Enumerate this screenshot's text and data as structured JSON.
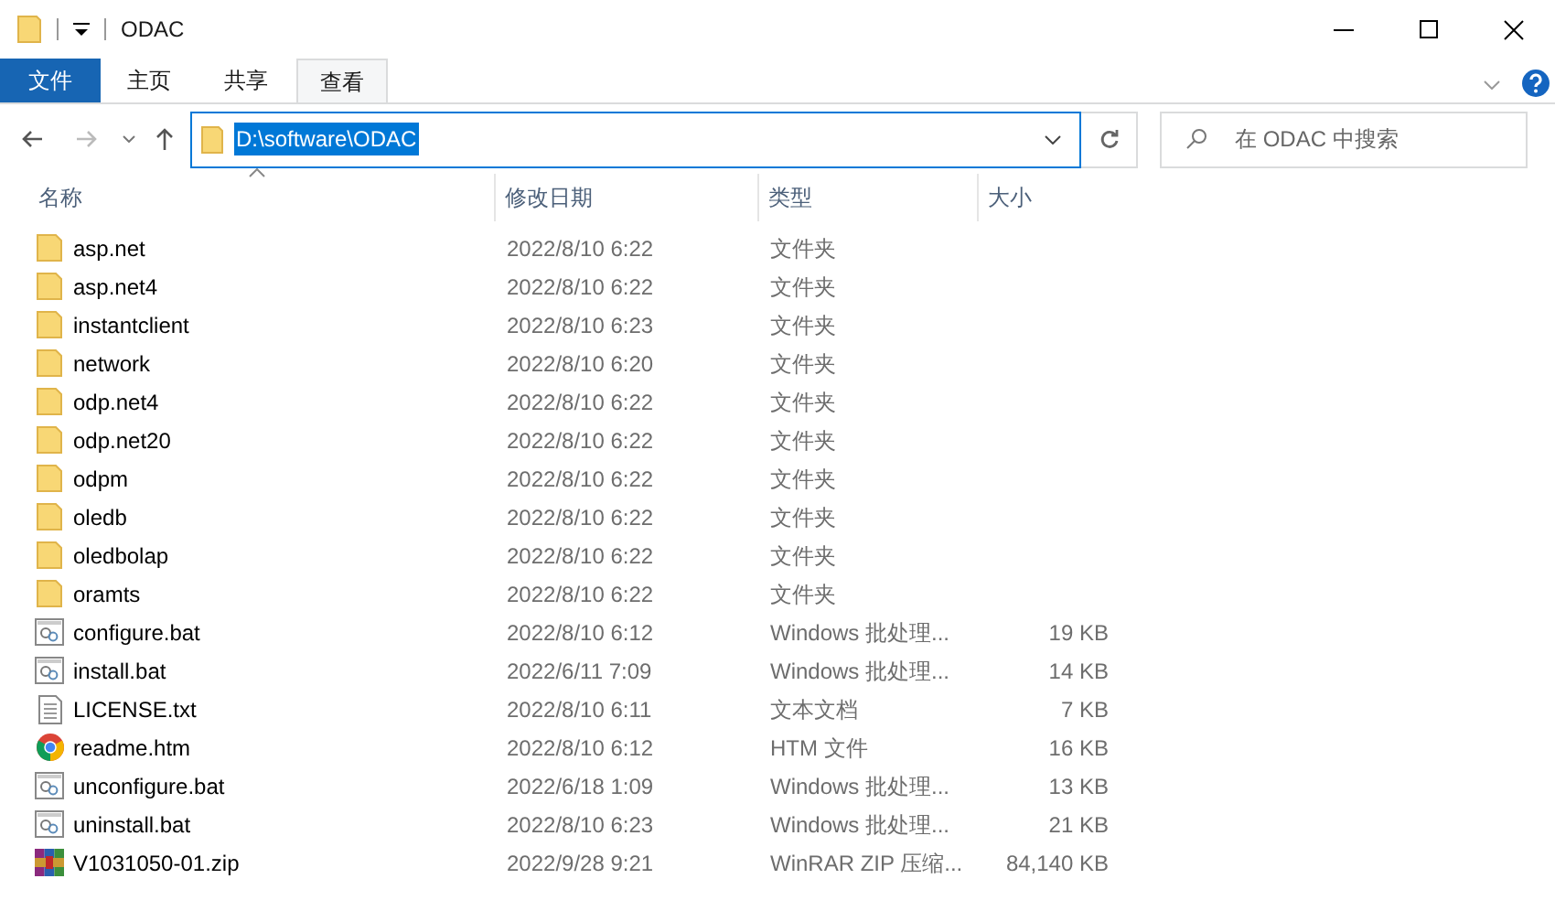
{
  "window": {
    "title": "ODAC"
  },
  "ribbon_tabs": [
    {
      "label": "文件",
      "kind": "file",
      "selected": false
    },
    {
      "label": "主页",
      "kind": "tab",
      "selected": false
    },
    {
      "label": "共享",
      "kind": "tab",
      "selected": false
    },
    {
      "label": "查看",
      "kind": "tab",
      "selected": true
    }
  ],
  "address_bar": {
    "value": "D:\\software\\ODAC"
  },
  "search": {
    "placeholder": "在 ODAC 中搜索"
  },
  "columns": [
    "名称",
    "修改日期",
    "类型",
    "大小"
  ],
  "files": [
    {
      "name": "asp.net",
      "date": "2022/8/10 6:22",
      "type": "文件夹",
      "kind": "folder"
    },
    {
      "name": "asp.net4",
      "date": "2022/8/10 6:22",
      "type": "文件夹",
      "kind": "folder"
    },
    {
      "name": "instantclient",
      "date": "2022/8/10 6:23",
      "type": "文件夹",
      "kind": "folder"
    },
    {
      "name": "network",
      "date": "2022/8/10 6:20",
      "type": "文件夹",
      "kind": "folder"
    },
    {
      "name": "odp.net4",
      "date": "2022/8/10 6:22",
      "type": "文件夹",
      "kind": "folder"
    },
    {
      "name": "odp.net20",
      "date": "2022/8/10 6:22",
      "type": "文件夹",
      "kind": "folder"
    },
    {
      "name": "odpm",
      "date": "2022/8/10 6:22",
      "type": "文件夹",
      "kind": "folder"
    },
    {
      "name": "oledb",
      "date": "2022/8/10 6:22",
      "type": "文件夹",
      "kind": "folder"
    },
    {
      "name": "oledbolap",
      "date": "2022/8/10 6:22",
      "type": "文件夹",
      "kind": "folder"
    },
    {
      "name": "oramts",
      "date": "2022/8/10 6:22",
      "type": "文件夹",
      "kind": "folder"
    },
    {
      "name": "configure.bat",
      "date": "2022/8/10 6:12",
      "type": "Windows 批处理...",
      "size": "19 KB",
      "kind": "bat"
    },
    {
      "name": "install.bat",
      "date": "2022/6/11 7:09",
      "type": "Windows 批处理...",
      "size": "14 KB",
      "kind": "bat"
    },
    {
      "name": "LICENSE.txt",
      "date": "2022/8/10 6:11",
      "type": "文本文档",
      "size": "7 KB",
      "kind": "txt"
    },
    {
      "name": "readme.htm",
      "date": "2022/8/10 6:12",
      "type": "HTM 文件",
      "size": "16 KB",
      "kind": "htm"
    },
    {
      "name": "unconfigure.bat",
      "date": "2022/6/18 1:09",
      "type": "Windows 批处理...",
      "size": "13 KB",
      "kind": "bat"
    },
    {
      "name": "uninstall.bat",
      "date": "2022/8/10 6:23",
      "type": "Windows 批处理...",
      "size": "21 KB",
      "kind": "bat"
    },
    {
      "name": "V1031050-01.zip",
      "date": "2022/9/28 9:21",
      "type": "WinRAR ZIP 压缩...",
      "size": "84,140 KB",
      "kind": "zip"
    }
  ]
}
